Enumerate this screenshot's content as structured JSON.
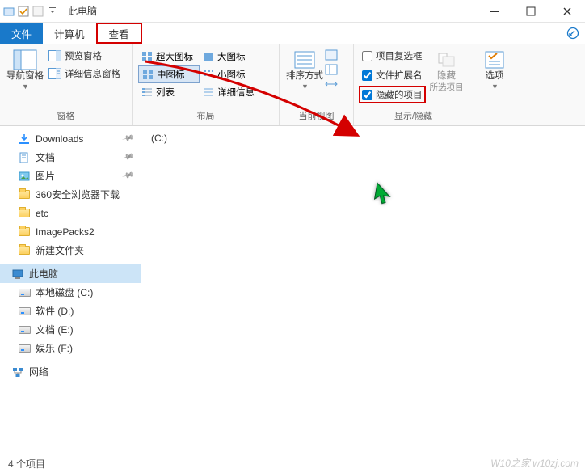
{
  "titlebar": {
    "title": "此电脑"
  },
  "tabs": {
    "file": "文件",
    "computer": "计算机",
    "view": "查看"
  },
  "ribbon": {
    "groups": {
      "panes": {
        "label": "窗格",
        "nav": "导航窗格",
        "preview": "预览窗格",
        "details": "详细信息窗格"
      },
      "layout": {
        "label": "布局",
        "cells": [
          "超大图标",
          "大图标",
          "中图标",
          "小图标",
          "列表",
          "详细信息"
        ]
      },
      "currentview": {
        "label": "当前视图",
        "sort": "排序方式"
      },
      "showhide": {
        "label": "显示/隐藏",
        "checkboxes": "项目复选框",
        "extensions": "文件扩展名",
        "hidden": "隐藏的项目",
        "hidebtn": "隐藏",
        "hidebtn2": "所选项目"
      },
      "options": {
        "label": "",
        "btn": "选项"
      }
    }
  },
  "sidebar": {
    "items": [
      {
        "label": "Downloads",
        "icon": "downloads",
        "pin": true
      },
      {
        "label": "文档",
        "icon": "docs",
        "pin": true
      },
      {
        "label": "图片",
        "icon": "pics",
        "pin": true
      },
      {
        "label": "360安全浏览器下载",
        "icon": "folder"
      },
      {
        "label": "etc",
        "icon": "folder"
      },
      {
        "label": "ImagePacks2",
        "icon": "folder"
      },
      {
        "label": "新建文件夹",
        "icon": "folder"
      }
    ],
    "thispc": {
      "label": "此电脑"
    },
    "drives": [
      {
        "label": "本地磁盘 (C:)"
      },
      {
        "label": "软件 (D:)"
      },
      {
        "label": "文档 (E:)"
      },
      {
        "label": "娱乐 (F:)"
      }
    ],
    "network": {
      "label": "网络"
    }
  },
  "content": {
    "drive": "(C:)"
  },
  "statusbar": {
    "text": "4 个项目"
  },
  "watermark": "W10之家 w10zj.com"
}
